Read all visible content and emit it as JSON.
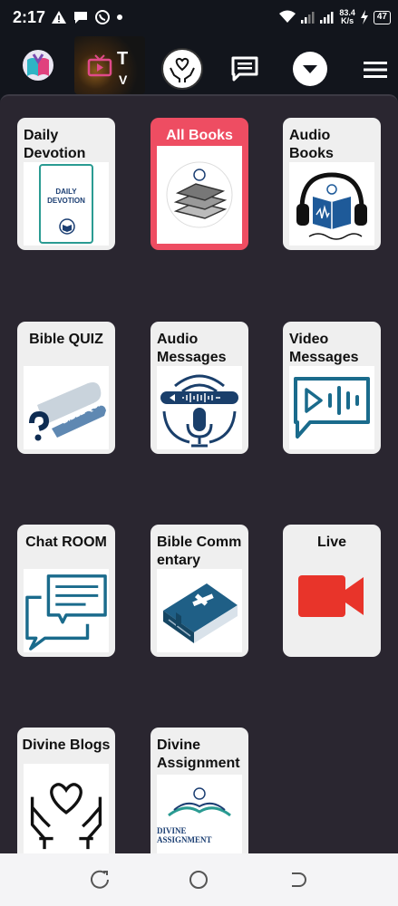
{
  "status": {
    "time": "2:17",
    "net_speed_value": "83.4",
    "net_speed_unit": "K/s",
    "battery": "47"
  },
  "tiles": [
    {
      "label": "Daily Devotion",
      "img_caption": "DAILY DEVOTION"
    },
    {
      "label": "All Books"
    },
    {
      "label": "Audio Books"
    },
    {
      "label": "Bible QUIZ",
      "img_caption": "BIBLE QUIZ"
    },
    {
      "label": "Audio Messages"
    },
    {
      "label": "Video Messages"
    },
    {
      "label": "Chat ROOM"
    },
    {
      "label": "Bible Commentary"
    },
    {
      "label": "Live"
    },
    {
      "label": "Divine Blogs"
    },
    {
      "label": "Divine Assignment",
      "img_caption": "DIVINE ASSIGNMENT"
    }
  ],
  "colors": {
    "background": "#12151c",
    "panel": "#2a2630",
    "tile": "#efefef",
    "active_tile": "#ee4d62",
    "icon_blue": "#1a6b8c",
    "live_red": "#e8342a"
  },
  "icons": {
    "logo": "app-logo-icon",
    "tv": "tv-icon",
    "care": "heart-hands-icon",
    "chat": "chat-icon",
    "dropdown": "chevron-down-icon",
    "menu": "hamburger-menu-icon"
  }
}
